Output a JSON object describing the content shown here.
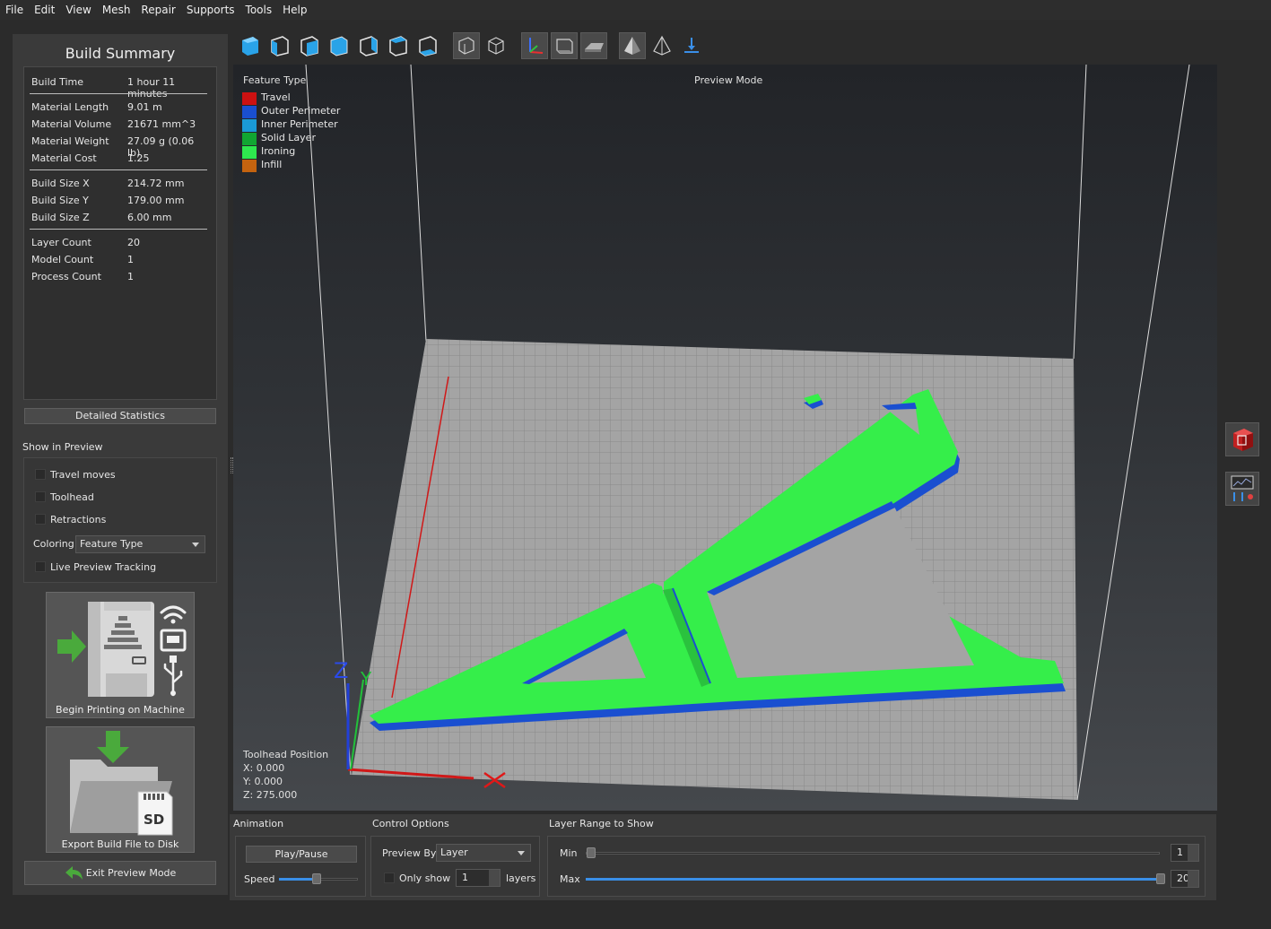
{
  "menu": [
    "File",
    "Edit",
    "View",
    "Mesh",
    "Repair",
    "Supports",
    "Tools",
    "Help"
  ],
  "summary": {
    "title": "Build Summary",
    "rows": [
      {
        "k": "Build Time",
        "v": "1 hour 11 minutes"
      },
      {
        "k": "Material Length",
        "v": "9.01 m"
      },
      {
        "k": "Material Volume",
        "v": "21671 mm^3"
      },
      {
        "k": "Material Weight",
        "v": "27.09 g (0.06 lb)"
      },
      {
        "k": "Material Cost",
        "v": "1.25"
      },
      {
        "k": "Build Size X",
        "v": "214.72 mm"
      },
      {
        "k": "Build Size Y",
        "v": "179.00 mm"
      },
      {
        "k": "Build Size Z",
        "v": "6.00 mm"
      },
      {
        "k": "Layer Count",
        "v": "20"
      },
      {
        "k": "Model Count",
        "v": "1"
      },
      {
        "k": "Process Count",
        "v": "1"
      }
    ],
    "detailed_label": "Detailed Statistics"
  },
  "show_in_preview": {
    "title": "Show in Preview",
    "travel": "Travel moves",
    "toolhead": "Toolhead",
    "retractions": "Retractions",
    "coloring_label": "Coloring",
    "coloring_value": "Feature Type",
    "live_tracking": "Live Preview Tracking"
  },
  "actions": {
    "begin_printing": "Begin Printing on Machine",
    "export": "Export Build File to Disk",
    "sd_label": "SD",
    "exit_preview": "Exit Preview Mode"
  },
  "viewport": {
    "legend_title": "Feature Type",
    "mode_label": "Preview Mode",
    "legend": [
      {
        "name": "Travel",
        "color": "#cc1111"
      },
      {
        "name": "Outer Perimeter",
        "color": "#1a4fd0"
      },
      {
        "name": "Inner Perimeter",
        "color": "#1a9ad6"
      },
      {
        "name": "Solid Layer",
        "color": "#11a632"
      },
      {
        "name": "Ironing",
        "color": "#2ee84e"
      },
      {
        "name": "Infill",
        "color": "#c4630f"
      }
    ],
    "toolhead_title": "Toolhead Position",
    "toolhead_x": "X: 0.000",
    "toolhead_y": "Y: 0.000",
    "toolhead_z": "Z: 275.000",
    "axis_z": "Z",
    "axis_y": "Y"
  },
  "animation": {
    "title": "Animation",
    "play_label": "Play/Pause",
    "speed_label": "Speed"
  },
  "control": {
    "title": "Control Options",
    "preview_by_label": "Preview By",
    "preview_by_value": "Layer",
    "only_show_label": "Only show",
    "only_show_value": "1",
    "layers_label": "layers"
  },
  "layer_range": {
    "title": "Layer Range to Show",
    "min_label": "Min",
    "min_value": "1",
    "max_label": "Max",
    "max_value": "20"
  }
}
